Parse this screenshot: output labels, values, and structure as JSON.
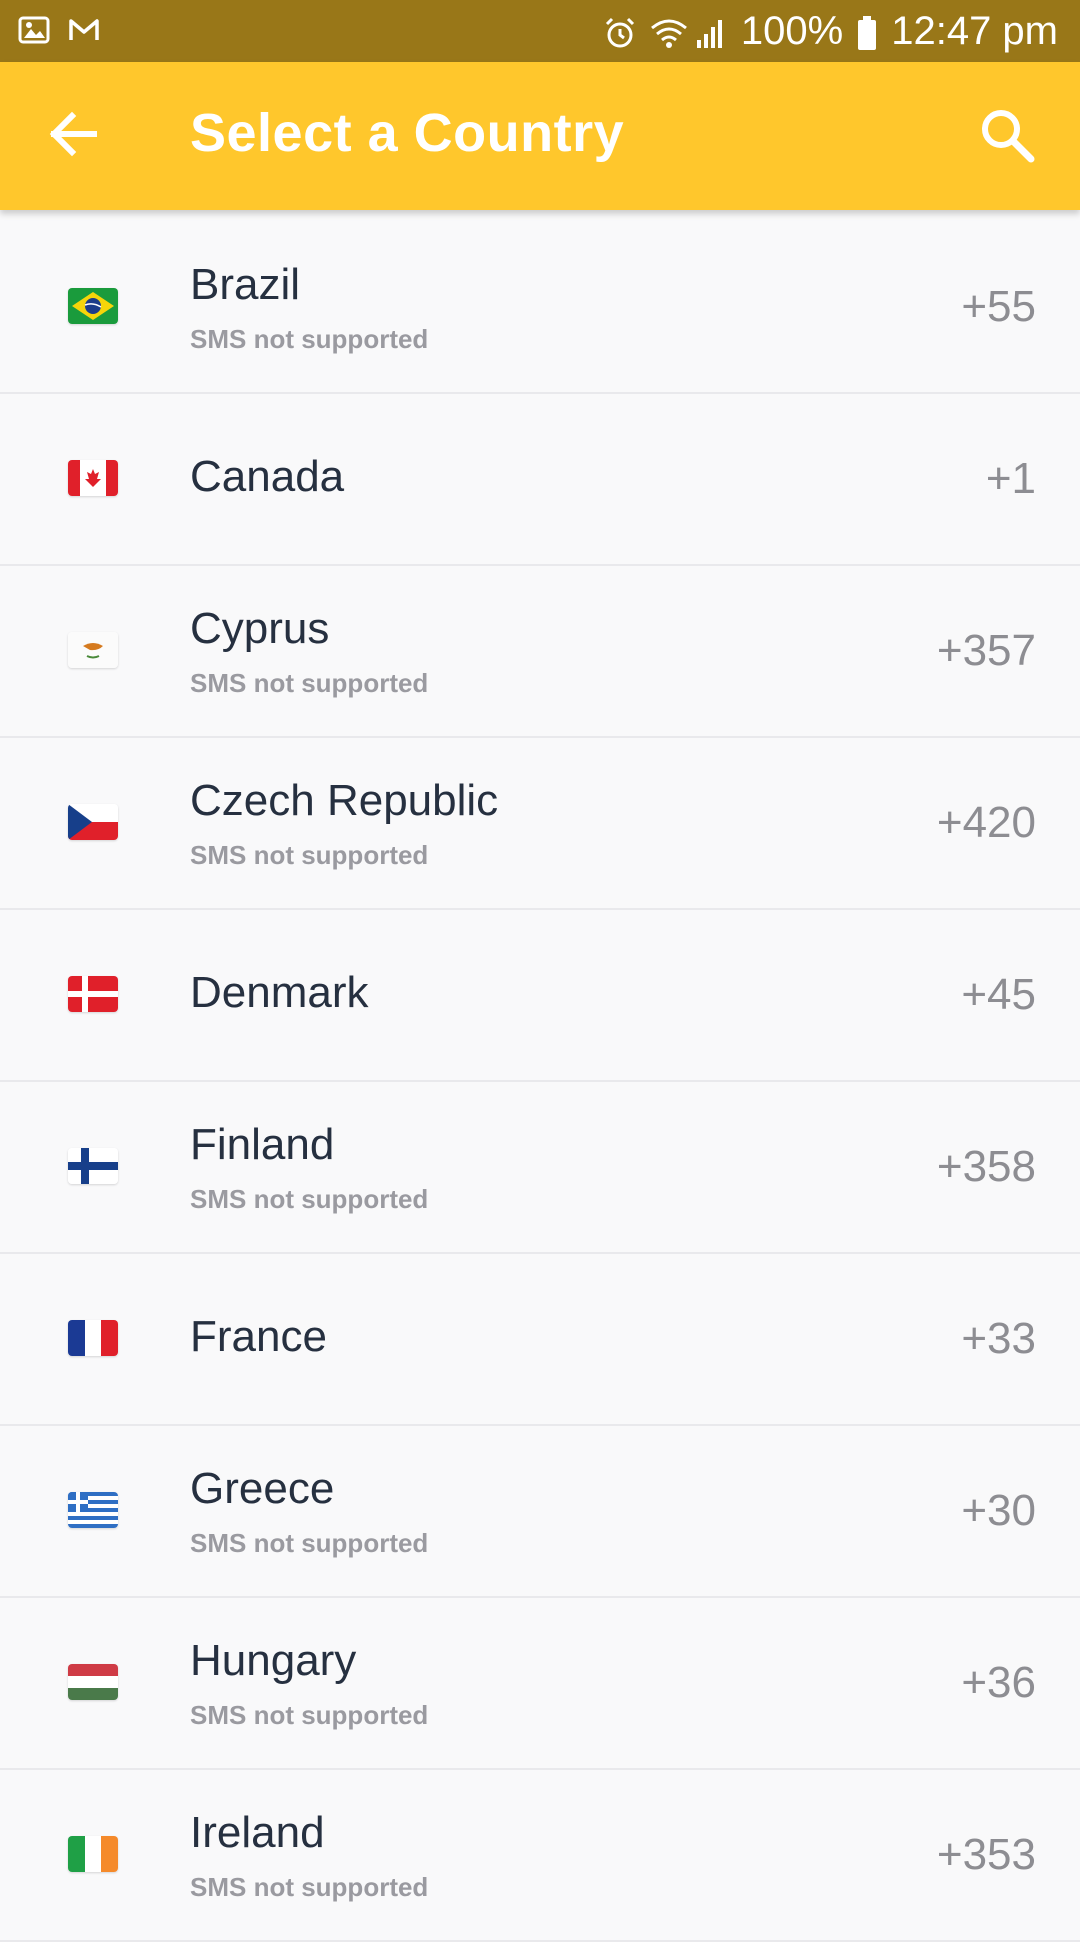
{
  "status_bar": {
    "battery_percent": "100%",
    "time": "12:47 pm",
    "left_icons": [
      "image-icon",
      "gmail-icon"
    ],
    "right_icons": [
      "alarm-icon",
      "wifi-icon",
      "signal-icon",
      "battery-icon"
    ]
  },
  "header": {
    "title": "Select a Country",
    "back_icon": "arrow-left-icon",
    "search_icon": "search-icon",
    "background": "#ffc72c"
  },
  "countries": [
    {
      "name": "Brazil",
      "note": "SMS not supported",
      "code": "+55"
    },
    {
      "name": "Canada",
      "note": "",
      "code": "+1"
    },
    {
      "name": "Cyprus",
      "note": "SMS not supported",
      "code": "+357"
    },
    {
      "name": "Czech Republic",
      "note": "SMS not supported",
      "code": "+420"
    },
    {
      "name": "Denmark",
      "note": "",
      "code": "+45"
    },
    {
      "name": "Finland",
      "note": "SMS not supported",
      "code": "+358"
    },
    {
      "name": "France",
      "note": "",
      "code": "+33"
    },
    {
      "name": "Greece",
      "note": "SMS not supported",
      "code": "+30"
    },
    {
      "name": "Hungary",
      "note": "SMS not supported",
      "code": "+36"
    },
    {
      "name": "Ireland",
      "note": "SMS not supported",
      "code": "+353"
    }
  ]
}
